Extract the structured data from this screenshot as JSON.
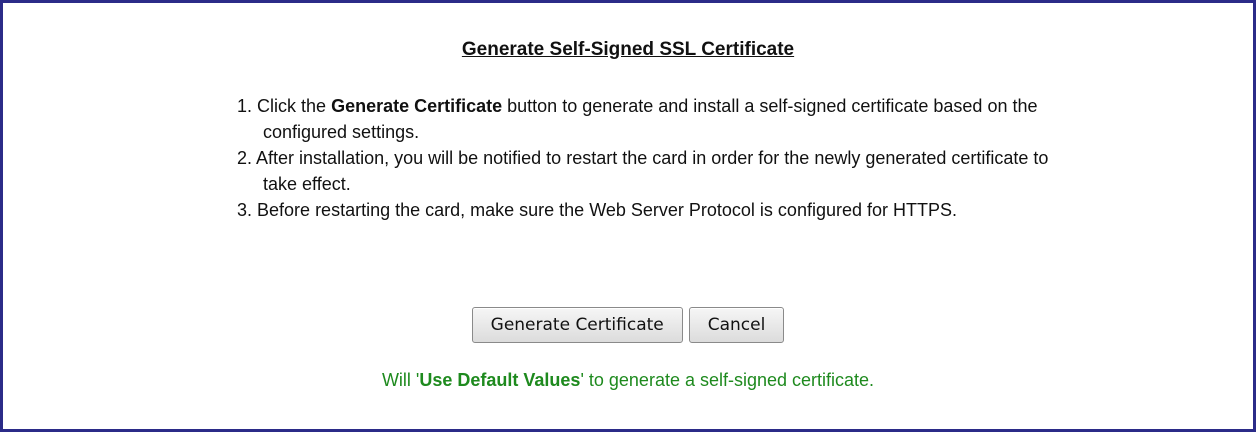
{
  "title": "Generate Self-Signed SSL Certificate",
  "steps": [
    {
      "num": "1.",
      "pre": "Click the ",
      "bold": "Generate Certificate",
      "post": " button to generate and install a self-signed certificate based on the configured settings."
    },
    {
      "num": "2.",
      "text": "After installation, you will be notified to restart the card in order for the newly generated certificate to take effect."
    },
    {
      "num": "3.",
      "text": "Before restarting the card, make sure the Web Server Protocol is configured for HTTPS."
    }
  ],
  "buttons": {
    "generate_label": "Generate Certificate",
    "cancel_label": "Cancel"
  },
  "note": {
    "pre": "Will '",
    "bold": "Use Default Values",
    "post": "' to generate a self-signed certificate."
  },
  "colors": {
    "border": "#2b2b88",
    "note_green": "#1e8a1e"
  }
}
